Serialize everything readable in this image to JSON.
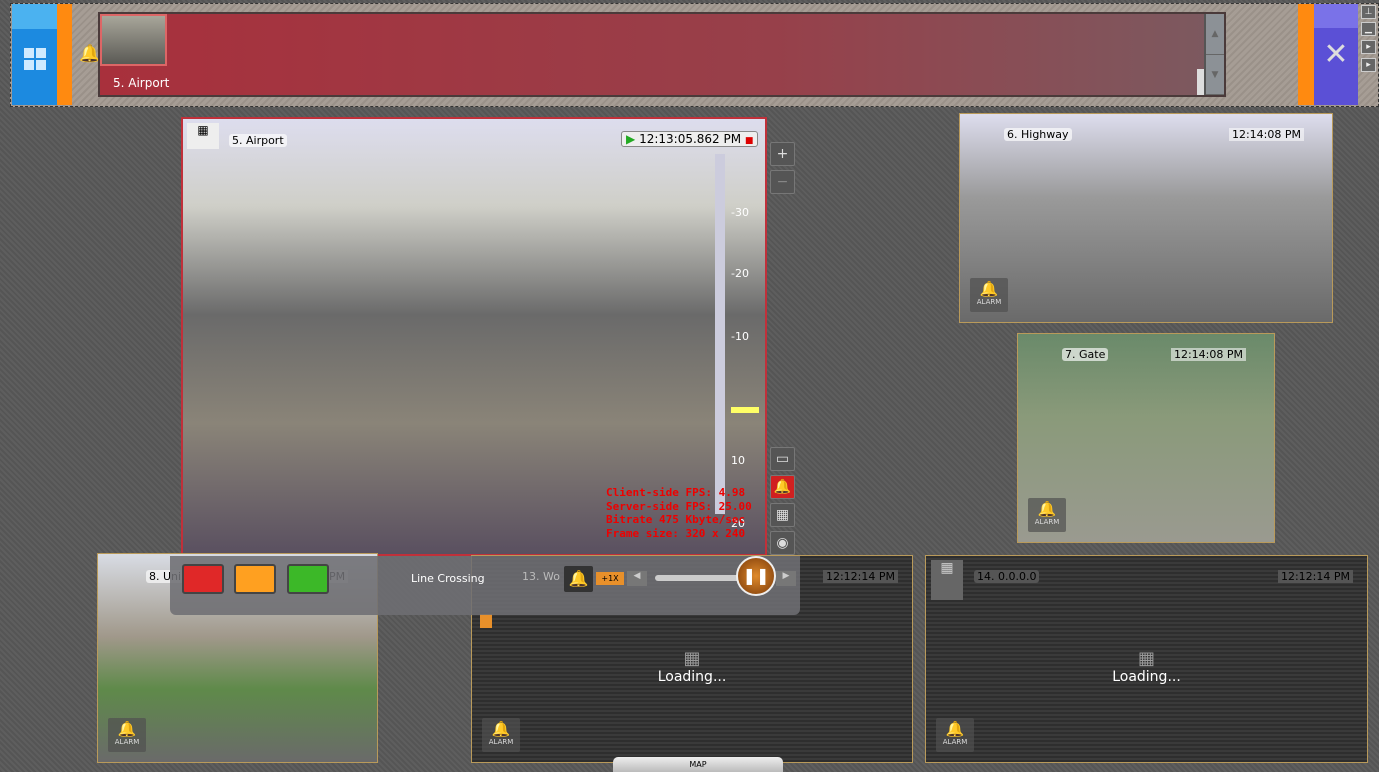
{
  "topbar": {
    "alarm_label": "5. Airport",
    "icons": [
      "grid-icon",
      "bell-icon",
      "tools-icon",
      "pin-icon",
      "minimize-icon"
    ]
  },
  "main_camera": {
    "name": "5. Airport",
    "timestamp": "12:13:05.862 PM",
    "stats": [
      "Client-side FPS:  4.98",
      "Server-side FPS: 25.00",
      "Bitrate 475 Kbyte/sec",
      "Frame size: 320 x 240"
    ],
    "scale_ticks": [
      "-30",
      "-20",
      "-10",
      "10",
      "20"
    ]
  },
  "controls": {
    "event_label": "Line Crossing",
    "speed": "+1X",
    "colors": {
      "red": "#e02828",
      "orange": "#ffa020",
      "green": "#3cb828"
    }
  },
  "cameras": [
    {
      "name": "6. Highway",
      "time": "12:14:08 PM",
      "alarm": "ALARM"
    },
    {
      "name": "7. Gate",
      "time": "12:14:08 PM",
      "alarm": "ALARM"
    },
    {
      "name": "8. Uni",
      "time": "PM",
      "alarm": "ALARM"
    },
    {
      "name": "13. Wo",
      "time": "12:12:14 PM",
      "alarm": "ALARM",
      "loading": "Loading..."
    },
    {
      "name": "14. 0.0.0.0",
      "time": "12:12:14 PM",
      "alarm": "ALARM",
      "loading": "Loading..."
    }
  ],
  "map_tab": "MAP"
}
